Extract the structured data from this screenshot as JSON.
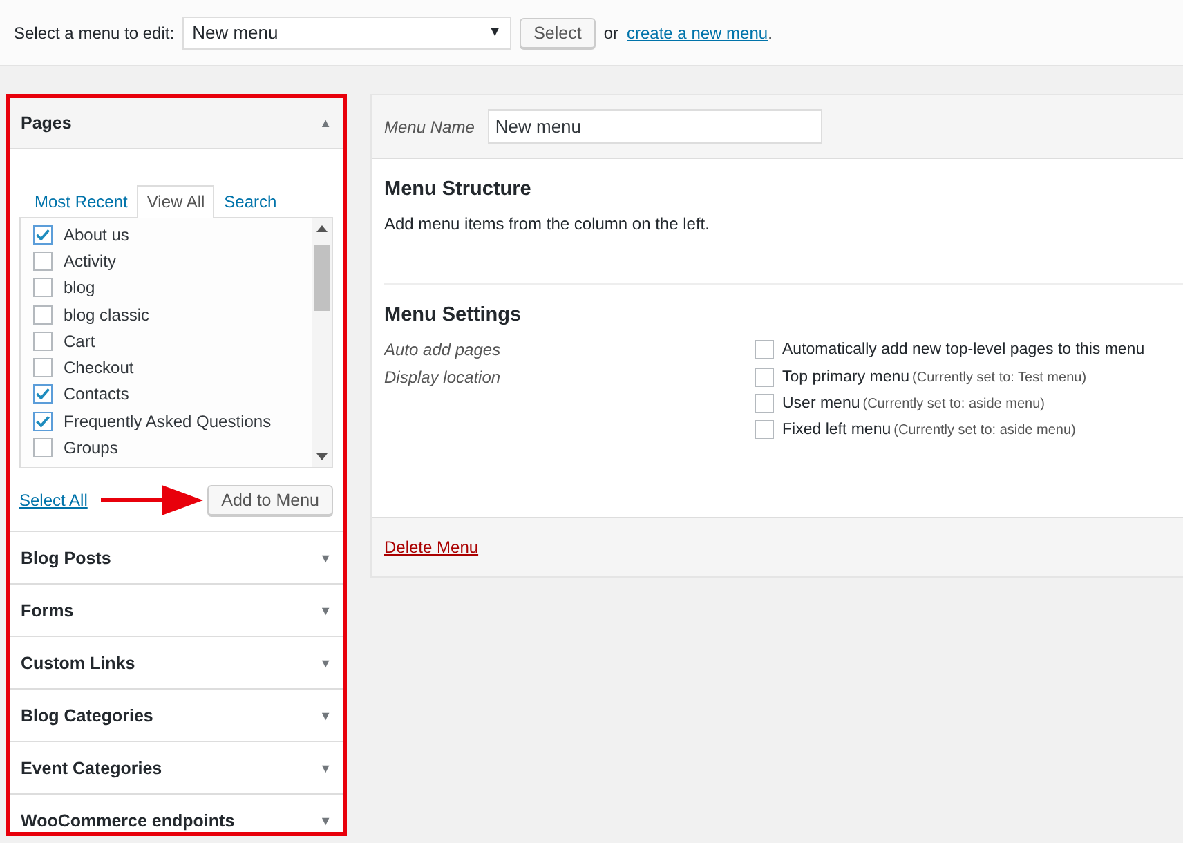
{
  "top_bar": {
    "label": "Select a menu to edit:",
    "dropdown": {
      "value": "New menu",
      "arrow": "▼"
    },
    "select_button": "Select",
    "or_text": "or",
    "create_link": "create a new menu",
    "period": "."
  },
  "pages_panel": {
    "title": "Pages",
    "toggle": "▲",
    "tabs": [
      {
        "label": "Most Recent",
        "selected": false
      },
      {
        "label": "View All",
        "selected": true
      },
      {
        "label": "Search",
        "selected": false
      }
    ],
    "items": [
      {
        "label": "About us",
        "checked": true
      },
      {
        "label": "Activity",
        "checked": false
      },
      {
        "label": "blog",
        "checked": false
      },
      {
        "label": "blog classic",
        "checked": false
      },
      {
        "label": "Cart",
        "checked": false
      },
      {
        "label": "Checkout",
        "checked": false
      },
      {
        "label": "Contacts",
        "checked": true
      },
      {
        "label": "Frequently Asked Questions",
        "checked": true
      },
      {
        "label": "Groups",
        "checked": false
      }
    ],
    "select_all": "Select All",
    "add_button": "Add to Menu"
  },
  "accordion": [
    {
      "title": "Blog Posts",
      "toggle": "▼"
    },
    {
      "title": "Forms",
      "toggle": "▼"
    },
    {
      "title": "Custom Links",
      "toggle": "▼"
    },
    {
      "title": "Blog Categories",
      "toggle": "▼"
    },
    {
      "title": "Event Categories",
      "toggle": "▼"
    },
    {
      "title": "WooCommerce endpoints",
      "toggle": "▼"
    }
  ],
  "menu_editor": {
    "name_label": "Menu Name",
    "name_value": "New menu",
    "structure_title": "Menu Structure",
    "structure_hint": "Add menu items from the column on the left.",
    "settings_title": "Menu Settings",
    "settings": [
      {
        "label": "Auto add pages",
        "options": [
          {
            "label": "Automatically add new top-level pages to this menu",
            "checked": false
          }
        ]
      },
      {
        "label": "Display location",
        "options": [
          {
            "label": "Top primary menu",
            "note": "(Currently set to: Test menu)",
            "checked": false
          },
          {
            "label": "User menu",
            "note": "(Currently set to: aside menu)",
            "checked": false
          },
          {
            "label": "Fixed left menu",
            "note": "(Currently set to: aside menu)",
            "checked": false
          }
        ]
      }
    ],
    "delete_link": "Delete Menu"
  }
}
